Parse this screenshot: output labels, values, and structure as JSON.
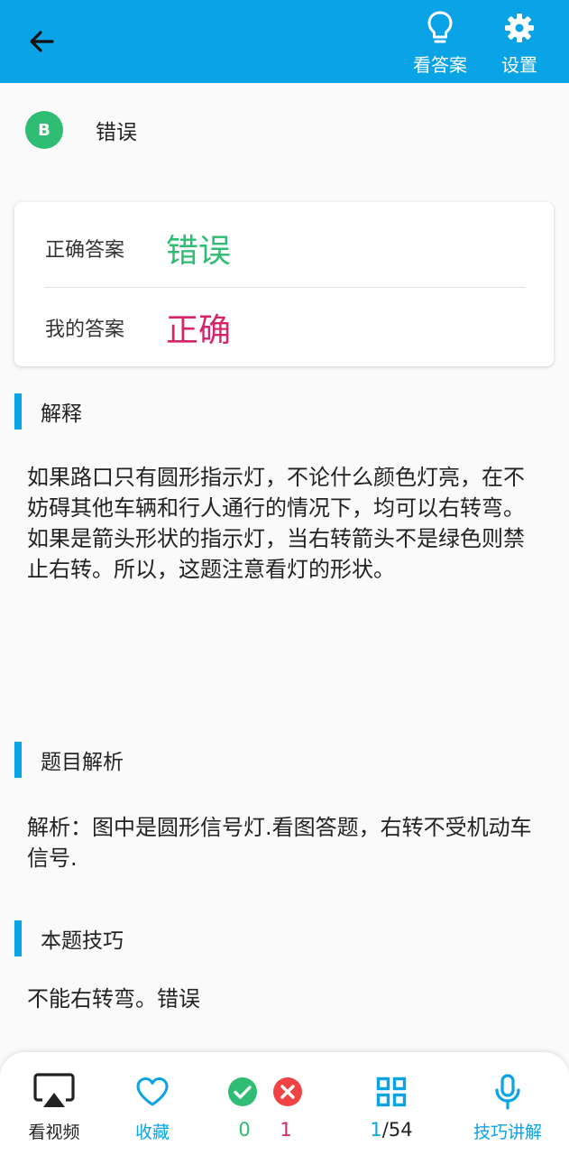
{
  "header": {
    "view_answer_label": "看答案",
    "settings_label": "设置"
  },
  "option": {
    "letter": "B",
    "text": "错误"
  },
  "answer_card": {
    "correct_label": "正确答案",
    "correct_value": "错误",
    "mine_label": "我的答案",
    "mine_value": "正确"
  },
  "sections": {
    "explanation": {
      "title": "解释",
      "body": "如果路口只有圆形指示灯，不论什么颜色灯亮，在不妨碍其他车辆和行人通行的情况下，均可以右转弯。如果是箭头形状的指示灯，当右转箭头不是绿色则禁止右转。所以，这题注意看灯的形状。"
    },
    "analysis": {
      "title": "题目解析",
      "body": "解析：图中是圆形信号灯.看图答题，右转不受机动车信号."
    },
    "tips": {
      "title": "本题技巧",
      "body": "不能右转弯。错误"
    }
  },
  "bottom_bar": {
    "video_label": "看视频",
    "favorite_label": "收藏",
    "right_count": "0",
    "wrong_count": "1",
    "page_current": "1",
    "page_total": "/54",
    "tips_label": "技巧讲解"
  },
  "colors": {
    "accent": "#0aa3e6",
    "correct": "#2ebd72",
    "wrong": "#d6246b",
    "wrong_icon": "#f04343"
  },
  "icons": {
    "back": "arrow-left-icon",
    "answer": "lightbulb-icon",
    "settings": "gear-icon",
    "video": "airplay-icon",
    "favorite": "heart-icon",
    "right": "check-circle-icon",
    "wrong": "x-circle-icon",
    "grid": "grid-icon",
    "tips": "microphone-icon"
  }
}
